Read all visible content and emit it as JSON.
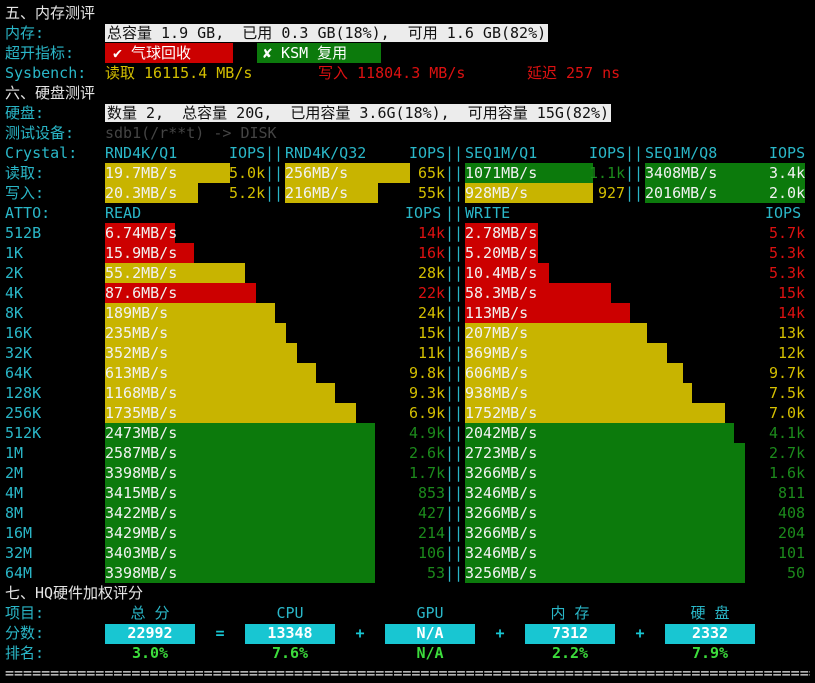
{
  "sec5": {
    "title": "五、内存测评",
    "mem_label": "内存:",
    "mem_value": "总容量 1.9 GB,  已用 0.3 GB(18%),  可用 1.6 GB(82%)",
    "oversell_label": "超开指标:",
    "balloon": "✔ 气球回收",
    "ksm": "✘ KSM 复用",
    "sysbench_label": "Sysbench:",
    "read": "读取 16115.4 MB/s",
    "write": "写入 11804.3 MB/s",
    "latency": "延迟 257 ns"
  },
  "sec6": {
    "title": "六、硬盘测评",
    "disk_label": "硬盘:",
    "disk_value": "数量 2,  总容量 20G,  已用容量 3.6G(18%),  可用容量 15G(82%)",
    "device_label": "测试设备:",
    "device_value": "sdb1(/r**t) -> DISK",
    "crystal_label": "Crystal:",
    "crystal_headers": [
      "RND4K/Q1",
      "IOPS",
      "RND4K/Q32",
      "IOPS",
      "SEQ1M/Q1",
      "IOPS",
      "SEQ1M/Q8",
      "IOPS"
    ],
    "read_label": "读取:",
    "write_label": "写入:",
    "crystal_read": [
      {
        "speed": "19.7MB/s",
        "iops": "5.0k",
        "fill": 0.78,
        "color": "yellow"
      },
      {
        "speed": "256MB/s",
        "iops": "65k",
        "fill": 0.78,
        "color": "yellow"
      },
      {
        "speed": "1071MB/s",
        "iops": "1.1k",
        "fill": 0.8,
        "color": "green"
      },
      {
        "speed": "3408MB/s",
        "iops": "3.4k",
        "fill": 1.0,
        "color": "green"
      }
    ],
    "crystal_write": [
      {
        "speed": "20.3MB/s",
        "iops": "5.2k",
        "fill": 0.58,
        "color": "yellow"
      },
      {
        "speed": "216MB/s",
        "iops": "55k",
        "fill": 0.58,
        "color": "yellow"
      },
      {
        "speed": "928MB/s",
        "iops": "927",
        "fill": 0.8,
        "color": "yellow"
      },
      {
        "speed": "2016MB/s",
        "iops": "2.0k",
        "fill": 1.0,
        "color": "green"
      }
    ],
    "atto_label": "ATTO:",
    "atto_read_header": "READ",
    "atto_write_header": "WRITE",
    "atto_iops_header": "IOPS",
    "atto_rows": [
      {
        "size": "512B",
        "r": "6.74MB/s",
        "ri": "14k",
        "rf": 0.26,
        "rc": "red",
        "w": "2.78MB/s",
        "wi": "5.7k",
        "wf": 0.26,
        "wc": "red"
      },
      {
        "size": "1K",
        "r": "15.9MB/s",
        "ri": "16k",
        "rf": 0.33,
        "rc": "red",
        "w": "5.20MB/s",
        "wi": "5.3k",
        "wf": 0.26,
        "wc": "red"
      },
      {
        "size": "2K",
        "r": "55.2MB/s",
        "ri": "28k",
        "rf": 0.52,
        "rc": "yellow",
        "w": "10.4MB/s",
        "wi": "5.3k",
        "wf": 0.3,
        "wc": "red"
      },
      {
        "size": "4K",
        "r": "87.6MB/s",
        "ri": "22k",
        "rf": 0.56,
        "rc": "red",
        "w": "58.3MB/s",
        "wi": "15k",
        "wf": 0.52,
        "wc": "red"
      },
      {
        "size": "8K",
        "r": "189MB/s",
        "ri": "24k",
        "rf": 0.63,
        "rc": "yellow",
        "w": "113MB/s",
        "wi": "14k",
        "wf": 0.59,
        "wc": "red"
      },
      {
        "size": "16K",
        "r": "235MB/s",
        "ri": "15k",
        "rf": 0.67,
        "rc": "yellow",
        "w": "207MB/s",
        "wi": "13k",
        "wf": 0.65,
        "wc": "yellow"
      },
      {
        "size": "32K",
        "r": "352MB/s",
        "ri": "11k",
        "rf": 0.71,
        "rc": "yellow",
        "w": "369MB/s",
        "wi": "12k",
        "wf": 0.72,
        "wc": "yellow"
      },
      {
        "size": "64K",
        "r": "613MB/s",
        "ri": "9.8k",
        "rf": 0.78,
        "rc": "yellow",
        "w": "606MB/s",
        "wi": "9.7k",
        "wf": 0.78,
        "wc": "yellow"
      },
      {
        "size": "128K",
        "r": "1168MB/s",
        "ri": "9.3k",
        "rf": 0.85,
        "rc": "yellow",
        "w": "938MB/s",
        "wi": "7.5k",
        "wf": 0.81,
        "wc": "yellow"
      },
      {
        "size": "256K",
        "r": "1735MB/s",
        "ri": "6.9k",
        "rf": 0.93,
        "rc": "yellow",
        "w": "1752MB/s",
        "wi": "7.0k",
        "wf": 0.93,
        "wc": "yellow"
      },
      {
        "size": "512K",
        "r": "2473MB/s",
        "ri": "4.9k",
        "rf": 1.0,
        "rc": "green",
        "w": "2042MB/s",
        "wi": "4.1k",
        "wf": 0.96,
        "wc": "green"
      },
      {
        "size": "1M",
        "r": "2587MB/s",
        "ri": "2.6k",
        "rf": 1.0,
        "rc": "green",
        "w": "2723MB/s",
        "wi": "2.7k",
        "wf": 1.0,
        "wc": "green"
      },
      {
        "size": "2M",
        "r": "3398MB/s",
        "ri": "1.7k",
        "rf": 1.0,
        "rc": "green",
        "w": "3266MB/s",
        "wi": "1.6k",
        "wf": 1.0,
        "wc": "green"
      },
      {
        "size": "4M",
        "r": "3415MB/s",
        "ri": "853",
        "rf": 1.0,
        "rc": "green",
        "w": "3246MB/s",
        "wi": "811",
        "wf": 1.0,
        "wc": "green"
      },
      {
        "size": "8M",
        "r": "3422MB/s",
        "ri": "427",
        "rf": 1.0,
        "rc": "green",
        "w": "3266MB/s",
        "wi": "408",
        "wf": 1.0,
        "wc": "green"
      },
      {
        "size": "16M",
        "r": "3429MB/s",
        "ri": "214",
        "rf": 1.0,
        "rc": "green",
        "w": "3266MB/s",
        "wi": "204",
        "wf": 1.0,
        "wc": "green"
      },
      {
        "size": "32M",
        "r": "3403MB/s",
        "ri": "106",
        "rf": 1.0,
        "rc": "green",
        "w": "3246MB/s",
        "wi": "101",
        "wf": 1.0,
        "wc": "green"
      },
      {
        "size": "64M",
        "r": "3398MB/s",
        "ri": "53",
        "rf": 1.0,
        "rc": "green",
        "w": "3256MB/s",
        "wi": "50",
        "wf": 1.0,
        "wc": "green"
      }
    ]
  },
  "sec7": {
    "title": "七、HQ硬件加权评分",
    "item_label": "项目:",
    "score_label": "分数:",
    "rank_label": "排名:",
    "items": [
      "总 分",
      "CPU",
      "GPU",
      "内 存",
      "硬 盘"
    ],
    "scores": [
      "22992",
      "13348",
      "N/A",
      "7312",
      "2332"
    ],
    "ops": [
      "=",
      "+",
      "+",
      "+"
    ],
    "ranks": [
      "3.0%",
      "7.6%",
      "N/A",
      "2.2%",
      "7.9%"
    ]
  },
  "footer_rule": "====================================================================================================="
}
